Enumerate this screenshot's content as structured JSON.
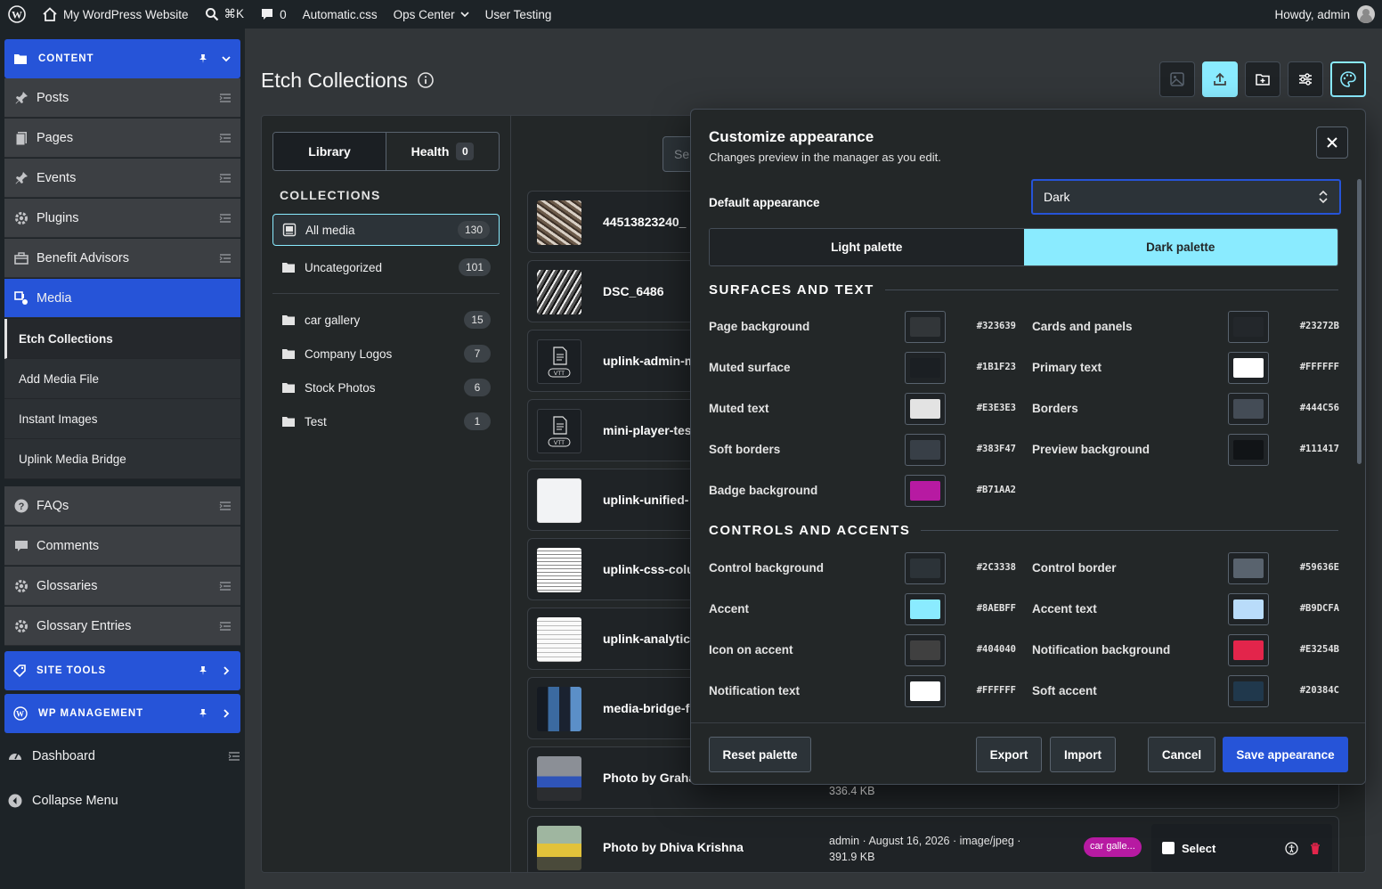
{
  "adminbar": {
    "site_name": "My WordPress Website",
    "search_shortcut": "⌘K",
    "comments_count": "0",
    "links": [
      "Automatic.css",
      "Ops Center",
      "User Testing"
    ],
    "greeting": "Howdy, admin"
  },
  "sidebar": {
    "content_group": "CONTENT",
    "content_items": [
      "Posts",
      "Pages",
      "Events",
      "Plugins",
      "Benefit Advisors"
    ],
    "media": "Media",
    "media_submenu": [
      "Etch Collections",
      "Add Media File",
      "Instant Images",
      "Uplink Media Bridge"
    ],
    "after_items": [
      "FAQs",
      "Comments",
      "Glossaries",
      "Glossary Entries"
    ],
    "site_tools": "SITE TOOLS",
    "wp_management": "WP MANAGEMENT",
    "dashboard": "Dashboard",
    "collapse": "Collapse Menu"
  },
  "page": {
    "title": "Etch Collections"
  },
  "collections_panel": {
    "tab_library": "Library",
    "tab_health": "Health",
    "health_count": "0",
    "heading": "COLLECTIONS",
    "items": [
      {
        "label": "All media",
        "count": "130"
      },
      {
        "label": "Uncategorized",
        "count": "101"
      },
      {
        "label": "car gallery",
        "count": "15"
      },
      {
        "label": "Company Logos",
        "count": "7"
      },
      {
        "label": "Stock Photos",
        "count": "6"
      },
      {
        "label": "Test",
        "count": "1"
      }
    ]
  },
  "media_list": {
    "search_placeholder": "Se",
    "rows": [
      {
        "name": "44513823240_"
      },
      {
        "name": "DSC_6486"
      },
      {
        "name": "uplink-admin-m"
      },
      {
        "name": "mini-player-tes"
      },
      {
        "name": "uplink-unified-"
      },
      {
        "name": "uplink-css-colu"
      },
      {
        "name": "uplink-analytics"
      },
      {
        "name": "media-bridge-f"
      },
      {
        "name": "Photo by Graha",
        "meta_line2": "336.4 KB"
      },
      {
        "name": "Photo by Dhiva Krishna",
        "meta_line1": "admin · August 16, 2026 · image/jpeg ·",
        "meta_line2": "391.9 KB",
        "tag": "car galle...",
        "select_label": "Select"
      }
    ],
    "vtt_label": "VTT"
  },
  "dialog": {
    "title": "Customize appearance",
    "subtitle": "Changes preview in the manager as you edit.",
    "default_label": "Default appearance",
    "default_value": "Dark",
    "tab_light": "Light palette",
    "tab_dark": "Dark palette",
    "section_surfaces": "SURFACES AND TEXT",
    "surfaces": [
      {
        "label": "Page background",
        "hex": "#323639"
      },
      {
        "label": "Cards and panels",
        "hex": "#23272B"
      },
      {
        "label": "Muted surface",
        "hex": "#1B1F23"
      },
      {
        "label": "Primary text",
        "hex": "#FFFFFF"
      },
      {
        "label": "Muted text",
        "hex": "#E3E3E3"
      },
      {
        "label": "Borders",
        "hex": "#444C56"
      },
      {
        "label": "Soft borders",
        "hex": "#383F47"
      },
      {
        "label": "Preview background",
        "hex": "#111417"
      },
      {
        "label": "Badge background",
        "hex": "#B71AA2"
      }
    ],
    "section_controls": "CONTROLS AND ACCENTS",
    "controls": [
      {
        "label": "Control background",
        "hex": "#2C3338"
      },
      {
        "label": "Control border",
        "hex": "#59636E"
      },
      {
        "label": "Accent",
        "hex": "#8AEBFF"
      },
      {
        "label": "Accent text",
        "hex": "#B9DCFA"
      },
      {
        "label": "Icon on accent",
        "hex": "#404040"
      },
      {
        "label": "Notification background",
        "hex": "#E3254B"
      },
      {
        "label": "Notification text",
        "hex": "#FFFFFF"
      },
      {
        "label": "Soft accent",
        "hex": "#20384C"
      }
    ],
    "footer": {
      "reset": "Reset palette",
      "export": "Export",
      "import": "Import",
      "cancel": "Cancel",
      "save": "Save appearance"
    }
  },
  "colors": {
    "brand_blue": "#2654D8",
    "accent": "#8AEBFF",
    "admin_bar": "#1D2327"
  }
}
